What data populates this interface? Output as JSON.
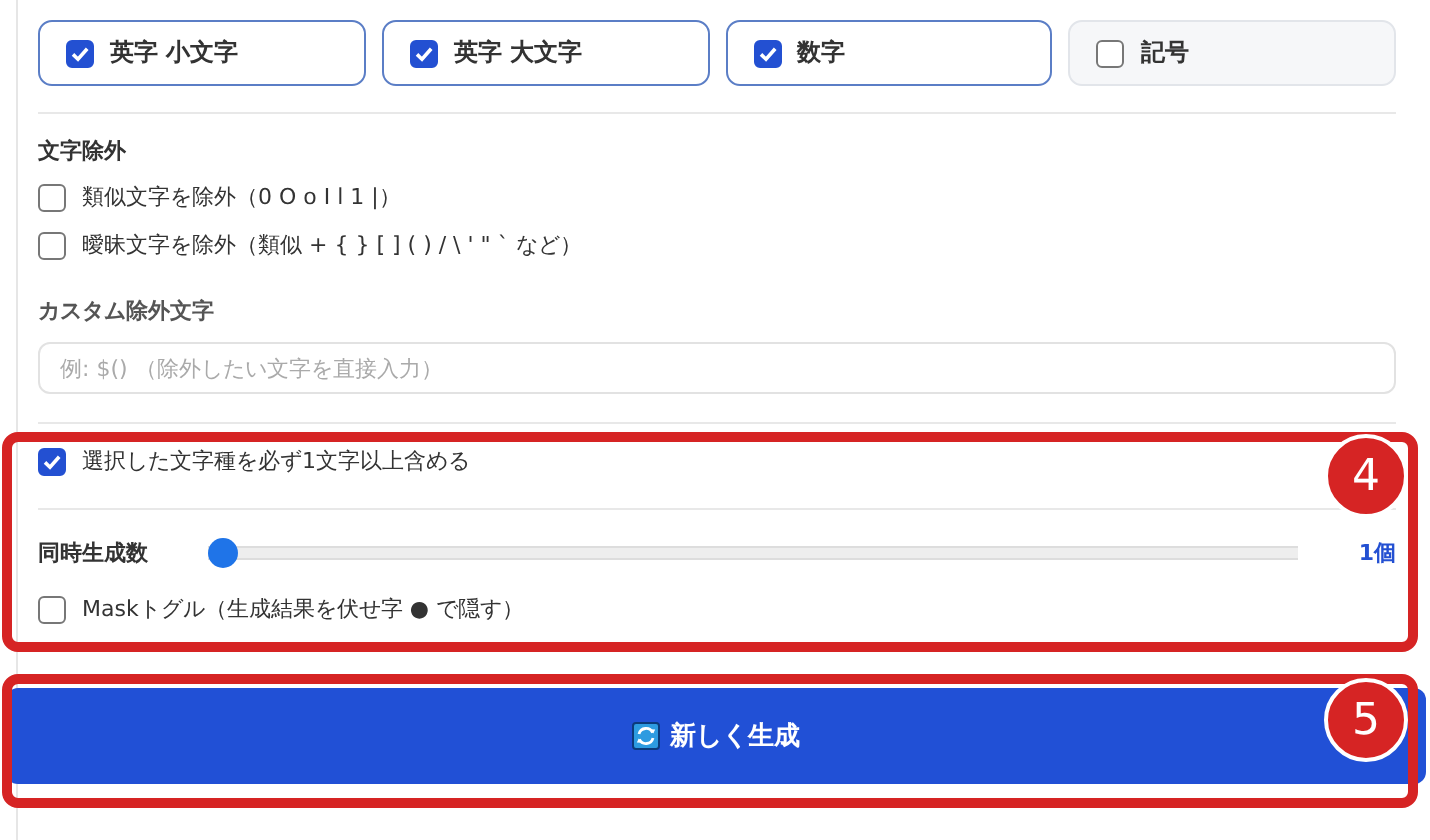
{
  "char_types": [
    {
      "label": "英字 小文字",
      "checked": true
    },
    {
      "label": "英字 大文字",
      "checked": true
    },
    {
      "label": "数字",
      "checked": true
    },
    {
      "label": "記号",
      "checked": false
    }
  ],
  "exclusion": {
    "title": "文字除外",
    "options": [
      {
        "label": "類似文字を除外（0 O o I l 1 |）",
        "checked": false
      },
      {
        "label": "曖昧文字を除外（類似 + { } [ ] ( ) / \\ ' \" ` など）",
        "checked": false
      }
    ]
  },
  "custom_exclusion": {
    "label": "カスタム除外文字",
    "placeholder": "例: $() （除外したい文字を直接入力）"
  },
  "generation_options": {
    "annotation": "4",
    "require_each": {
      "label": "選択した文字種を必ず1文字以上含める",
      "checked": true
    },
    "count": {
      "label": "同時生成数",
      "level": 0,
      "value": "1個"
    },
    "mask": {
      "label": "Maskトグル（生成結果を伏せ字 ● で隠す）",
      "checked": false
    }
  },
  "generate_button": {
    "label": "新しく生成",
    "annotation": "5"
  }
}
